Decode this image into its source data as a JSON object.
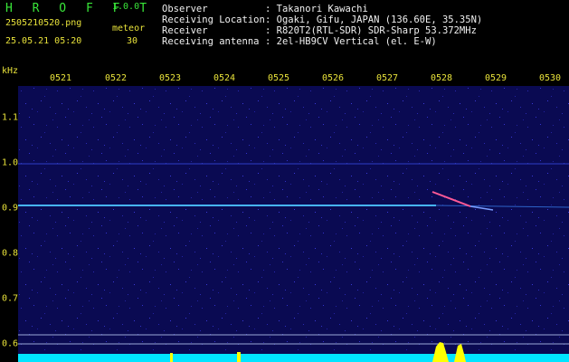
{
  "brand": "H R O F F T",
  "version": "1.0.0",
  "filename": "2505210520.png",
  "datetime": "25.05.21 05:20",
  "meteor": {
    "label": "meteor",
    "count": "30"
  },
  "info": [
    {
      "key": "Observer",
      "value": ": Takanori Kawachi"
    },
    {
      "key": "Receiving Location",
      "value": ": Ogaki, Gifu, JAPAN (136.60E, 35.35N)"
    },
    {
      "key": "Receiver",
      "value": ": R820T2(RTL-SDR) SDR-Sharp 53.372MHz"
    },
    {
      "key": "Receiving antenna",
      "value": ": 2el-HB9CV Vertical (el. E-W)"
    }
  ],
  "axis": {
    "y_unit": "kHz",
    "y_ticks": [
      "1.1",
      "1.0",
      "0.9",
      "0.8",
      "0.7",
      "0.6"
    ],
    "x_ticks": [
      "0521",
      "0522",
      "0523",
      "0524",
      "0525",
      "0526",
      "0527",
      "0528",
      "0529",
      "0530"
    ]
  },
  "colors": {
    "background": "#0a0a52",
    "carrier": "#46b4ff",
    "meteor_echo": "#ff5a96",
    "activity_bar": "#00e5ff",
    "activity_peak": "#ffff00"
  }
}
